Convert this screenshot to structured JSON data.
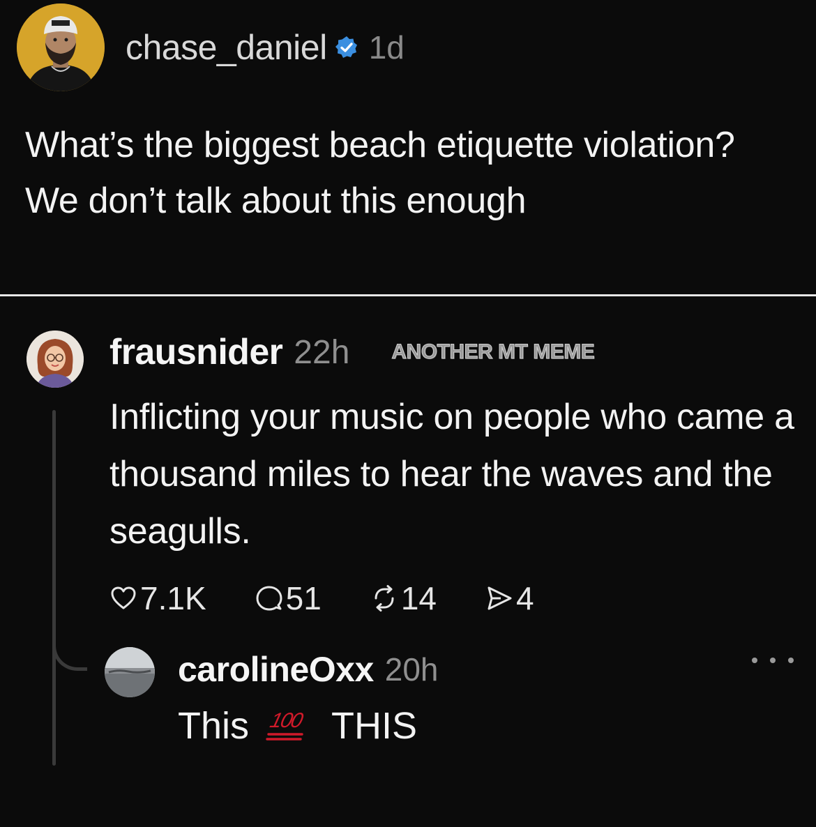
{
  "post": {
    "username": "chase_daniel",
    "verified_icon": "verified-badge-icon",
    "time": "1d",
    "text": "What’s the biggest beach etiquette violation? We don’t talk about this enough"
  },
  "reply": {
    "username": "frausnider",
    "time": "22h",
    "watermark": "ANOTHER MT MEME",
    "text": "Inflicting your music on people who came a thousand miles to hear the waves and the seagulls.",
    "actions": {
      "likes": "7.1K",
      "comments": "51",
      "reposts": "14",
      "shares": "4"
    }
  },
  "sub_reply": {
    "username": "carolineOxx",
    "time": "20h",
    "text_before": "This",
    "emoji_icon": "hundred-points-icon",
    "text_after": "THIS"
  },
  "colors": {
    "background": "#0b0b0b",
    "verified_blue": "#3b8fe0",
    "hundred_red": "#d01a2a"
  }
}
